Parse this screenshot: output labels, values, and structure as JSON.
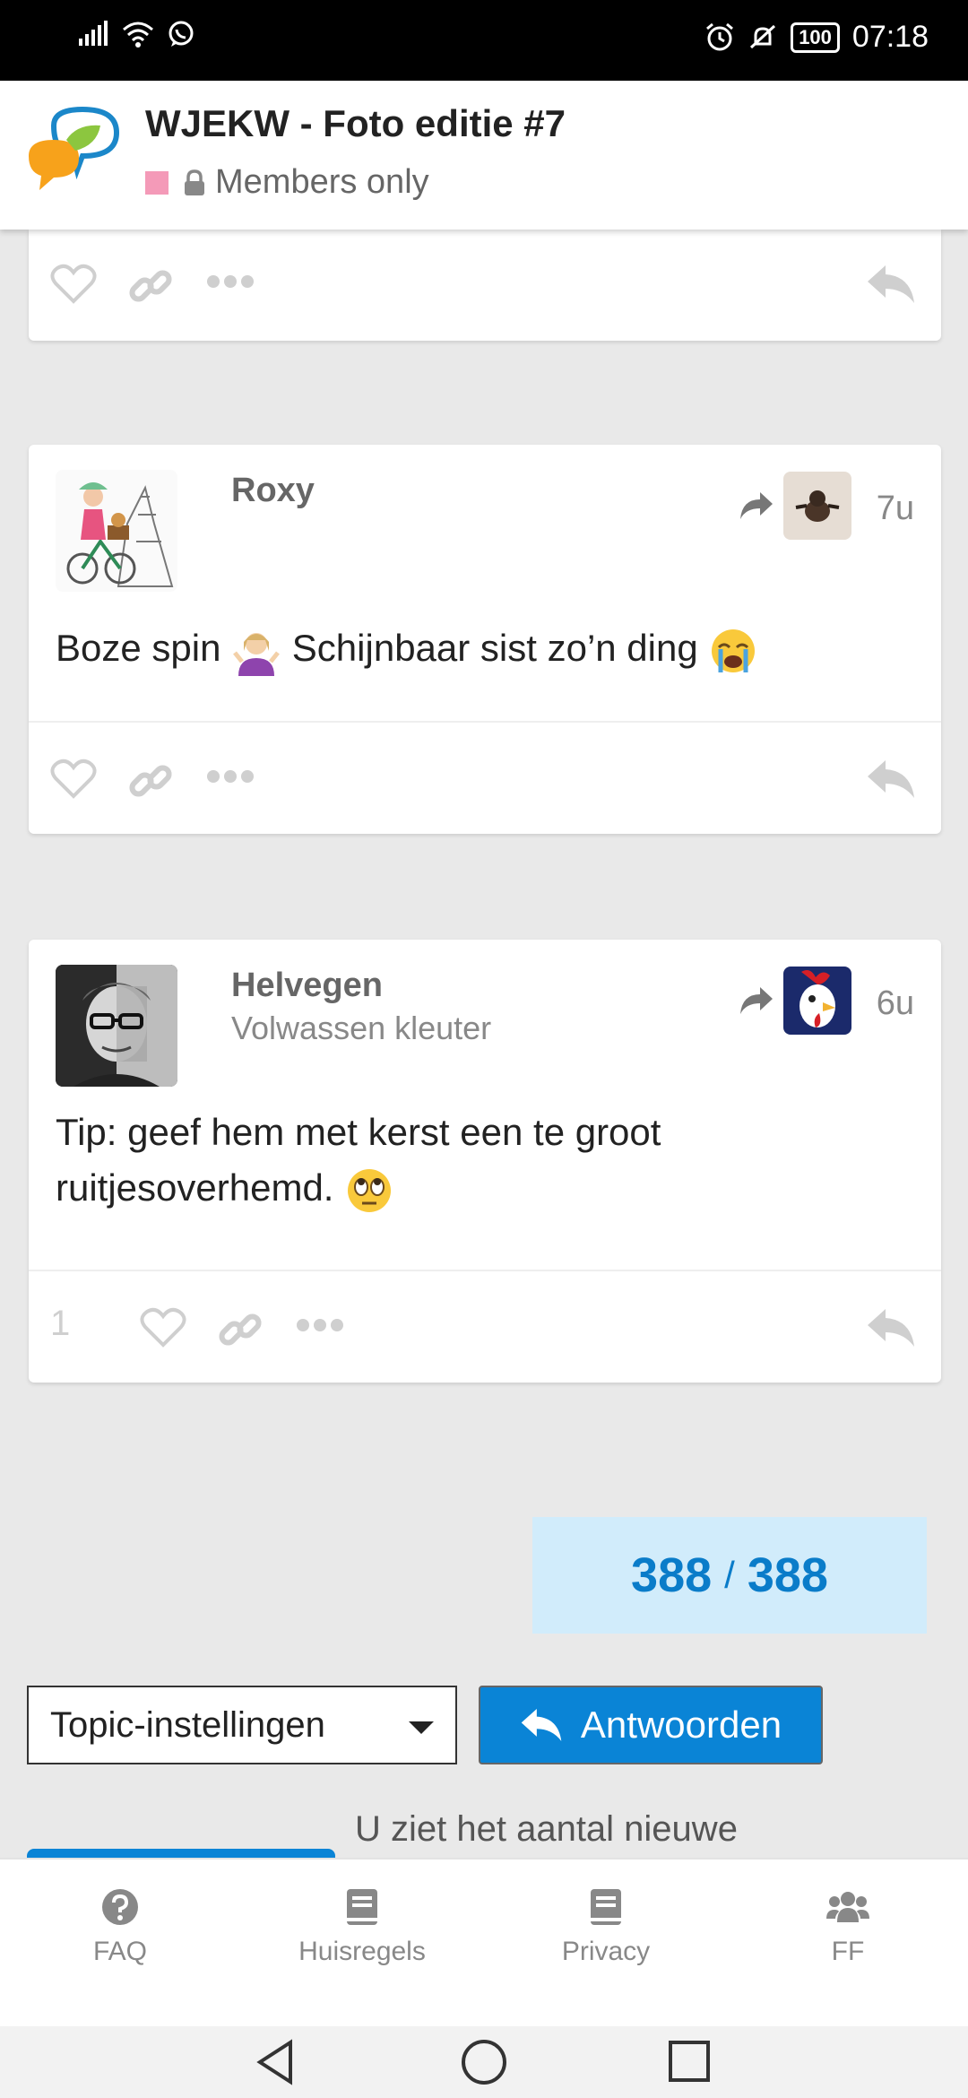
{
  "status_bar": {
    "time": "07:18",
    "battery": "100",
    "icons": [
      "signal-icon",
      "wifi-icon",
      "whatsapp-icon",
      "alarm-icon",
      "mute-icon",
      "battery-icon"
    ]
  },
  "header": {
    "title": "WJEKW - Foto editie #7",
    "category_color": "#f49ab8",
    "visibility": "Members only"
  },
  "posts": [
    {
      "author": "Roxy",
      "user_title": "",
      "age": "7u",
      "text": "Boze spin",
      "text_after": "Schijnbaar sist zo’n ding",
      "likes": ""
    },
    {
      "author": "Helvegen",
      "user_title": "Volwassen kleuter",
      "age": "6u",
      "text": "Tip: geef hem met kerst een te groot ruitjesoverhemd.",
      "likes": "1"
    }
  ],
  "progress": {
    "current": "388",
    "separator": "/",
    "total": "388"
  },
  "controls": {
    "topic_settings_label": "Topic-instellingen",
    "reply_label": "Antwoorden",
    "new_info_text": "U ziet het aantal nieuwe"
  },
  "bottom_nav": [
    {
      "label": "FAQ",
      "icon": "question-icon"
    },
    {
      "label": "Huisregels",
      "icon": "book-icon"
    },
    {
      "label": "Privacy",
      "icon": "book-icon"
    },
    {
      "label": "FF",
      "icon": "users-icon"
    }
  ],
  "colors": {
    "accent": "#0a84d6",
    "progress_bg": "#d1ecfb",
    "progress_text": "#0a7cc9"
  }
}
